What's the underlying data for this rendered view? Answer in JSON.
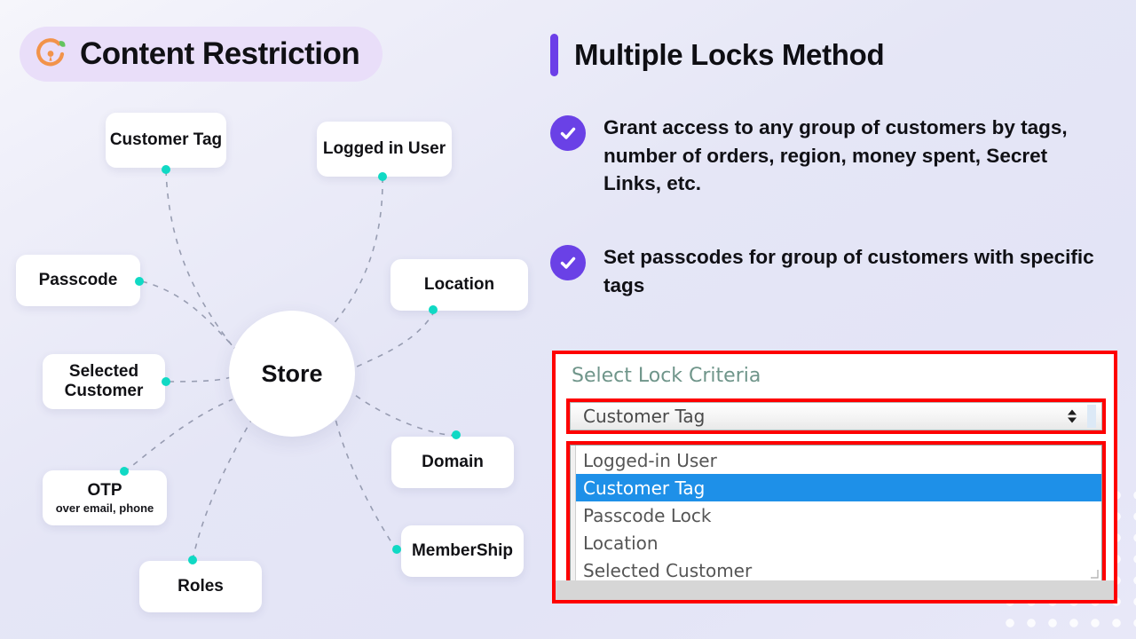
{
  "brand": {
    "title": "Content Restriction",
    "logo_icon": "lock-circle-leaf-icon",
    "pill_color": "#e9def9",
    "accent_orange": "#f2934a",
    "accent_green": "#63c35e"
  },
  "mindmap": {
    "center": {
      "label": "Store"
    },
    "node_dot_color": "#10d9c4",
    "nodes": [
      {
        "label": "Customer Tag",
        "sub": ""
      },
      {
        "label": "Logged in User",
        "sub": ""
      },
      {
        "label": "Passcode",
        "sub": ""
      },
      {
        "label": "Location",
        "sub": ""
      },
      {
        "label": "Selected Customer",
        "sub": ""
      },
      {
        "label": "Domain",
        "sub": ""
      },
      {
        "label": "OTP",
        "sub": "over email, phone"
      },
      {
        "label": "MemberShip",
        "sub": ""
      },
      {
        "label": "Roles",
        "sub": ""
      }
    ]
  },
  "right_panel": {
    "title": "Multiple Locks Method",
    "accent_bar_color": "#6c3fe8",
    "check_color": "#6a41e6",
    "bullets": [
      "Grant access to any group of customers by tags, number of orders, region, money spent, Secret Links, etc.",
      "Set passcodes for group of customers with specific tags"
    ]
  },
  "select_widget": {
    "label": "Select Lock Criteria",
    "label_color": "#6f958a",
    "selected_value": "Customer Tag",
    "highlight_color": "#1e90e8",
    "annotation_color": "#fe0000",
    "options": [
      "Logged-in User",
      "Customer Tag",
      "Passcode Lock",
      "Location",
      "Selected Customer"
    ],
    "highlighted_option": "Customer Tag",
    "stepper_icon": "up-down-caret-icon",
    "resize_icon": "resize-grip-icon"
  }
}
